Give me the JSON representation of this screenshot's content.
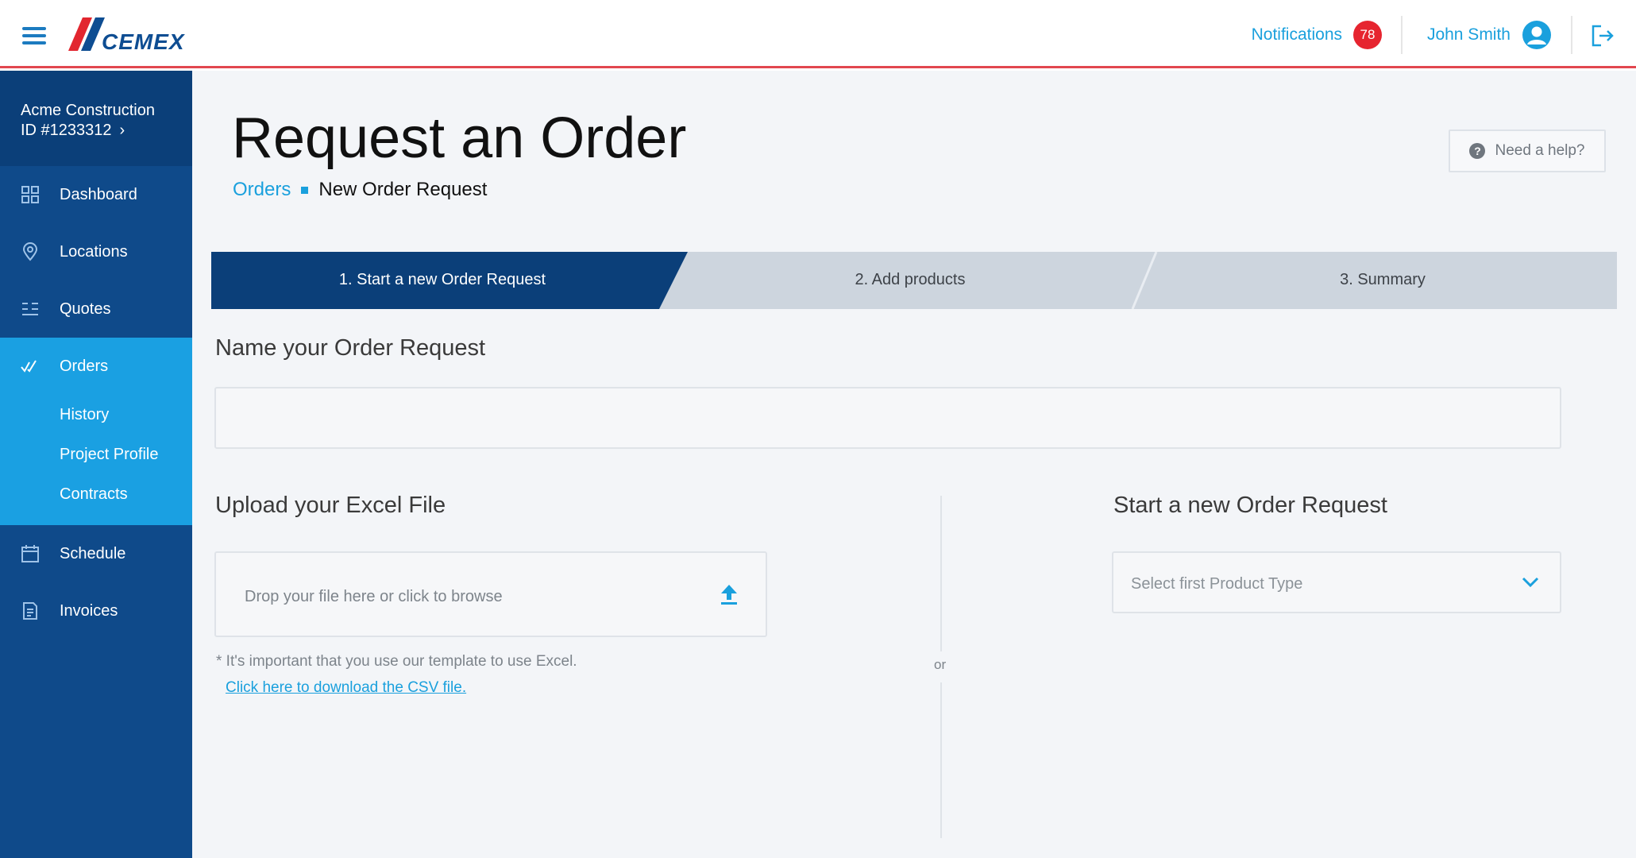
{
  "header": {
    "brand": "CEMEX",
    "notifications_label": "Notifications",
    "notifications_count": "78",
    "user_name": "John Smith"
  },
  "sidebar": {
    "account_name": "Acme Construction",
    "account_id": "ID #1233312",
    "items": [
      {
        "label": "Dashboard",
        "icon": "dashboard-icon"
      },
      {
        "label": "Locations",
        "icon": "location-pin-icon"
      },
      {
        "label": "Quotes",
        "icon": "quotes-list-icon"
      },
      {
        "label": "Orders",
        "icon": "double-check-icon"
      },
      {
        "label": "Schedule",
        "icon": "calendar-icon"
      },
      {
        "label": "Invoices",
        "icon": "invoice-icon"
      }
    ],
    "orders_subitems": [
      "History",
      "Project Profile",
      "Contracts"
    ]
  },
  "page": {
    "title": "Request an Order",
    "breadcrumb_link": "Orders",
    "breadcrumb_current": "New Order Request",
    "help_label": "Need a help?"
  },
  "steps": [
    {
      "label": "1. Start a new Order Request",
      "active": true
    },
    {
      "label": "2. Add products",
      "active": false
    },
    {
      "label": "3. Summary",
      "active": false
    }
  ],
  "form": {
    "name_title": "Name your Order Request",
    "name_value": "",
    "upload_title": "Upload your Excel File",
    "dropzone_text": "Drop your file here or click to browse",
    "note": "* It's important that you use our template to use Excel.",
    "csv_link": "Click here to download the CSV file.",
    "or": "or",
    "new_title": "Start a new Order Request",
    "select_placeholder": "Select first Product Type"
  },
  "colors": {
    "sidebar": "#0f4a8a",
    "sidebar_dark": "#0b3f79",
    "accent": "#1aa0e2",
    "step_active": "#0b3f79",
    "step_inactive": "#cdd5de",
    "badge": "#e6242f",
    "header_border": "#e2474f"
  }
}
